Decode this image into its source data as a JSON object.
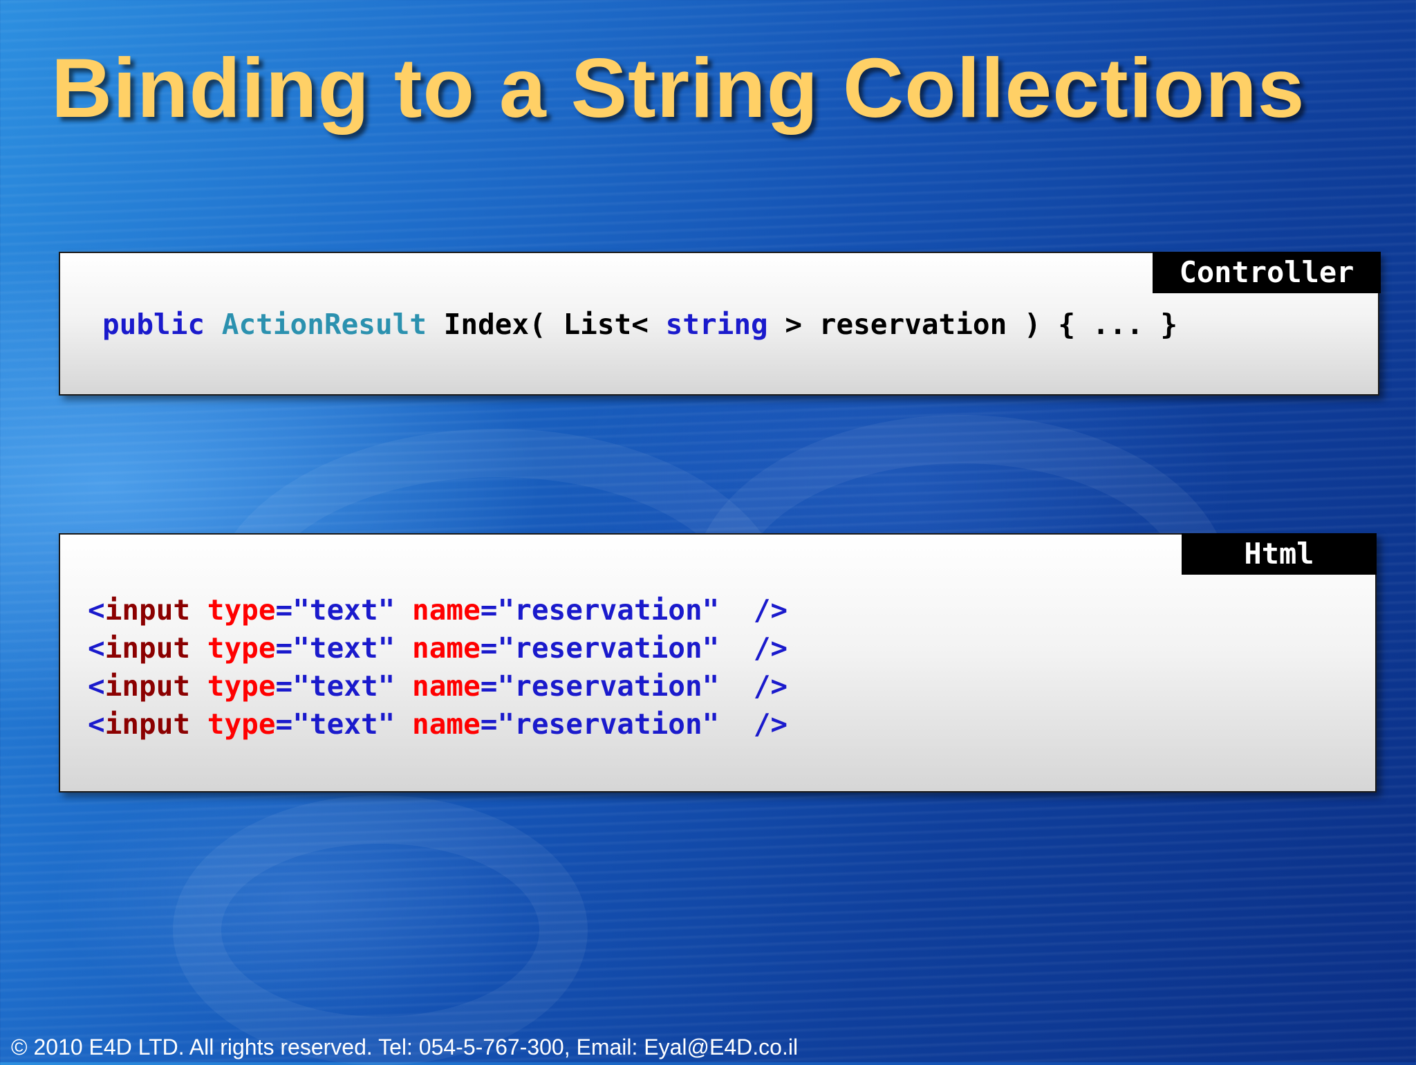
{
  "slide": {
    "title": "Binding to a String Collections",
    "footer": "© 2010 E4D LTD. All rights reserved. Tel: 054-5-767-300, Email: Eyal@E4D.co.il"
  },
  "controller_box": {
    "label": "Controller",
    "code": {
      "kw_public": "public",
      "type_actionresult": "ActionResult",
      "text_index": " Index( List< ",
      "kw_string": "string",
      "text_rest": " > reservation ) { ... }"
    }
  },
  "html_box": {
    "label": "Html",
    "lines": [
      {
        "open": "<",
        "element": "input",
        "attr_type": "type",
        "eq1": "=",
        "val_type": "\"text\"",
        "attr_name": "name",
        "eq2": "=",
        "val_name": "\"reservation\"",
        "close": "/>"
      },
      {
        "open": "<",
        "element": "input",
        "attr_type": "type",
        "eq1": "=",
        "val_type": "\"text\"",
        "attr_name": "name",
        "eq2": "=",
        "val_name": "\"reservation\"",
        "close": "/>"
      },
      {
        "open": "<",
        "element": "input",
        "attr_type": "type",
        "eq1": "=",
        "val_type": "\"text\"",
        "attr_name": "name",
        "eq2": "=",
        "val_name": "\"reservation\"",
        "close": "/>"
      },
      {
        "open": "<",
        "element": "input",
        "attr_type": "type",
        "eq1": "=",
        "val_type": "\"text\"",
        "attr_name": "name",
        "eq2": "=",
        "val_name": "\"reservation\"",
        "close": "/>"
      }
    ]
  },
  "colors": {
    "title": "#ffd066",
    "keyword": "#1a1acc",
    "type_name": "#2b91af",
    "element_name": "#8b0000",
    "attribute_name": "#ff0000",
    "label_background": "#000000"
  }
}
